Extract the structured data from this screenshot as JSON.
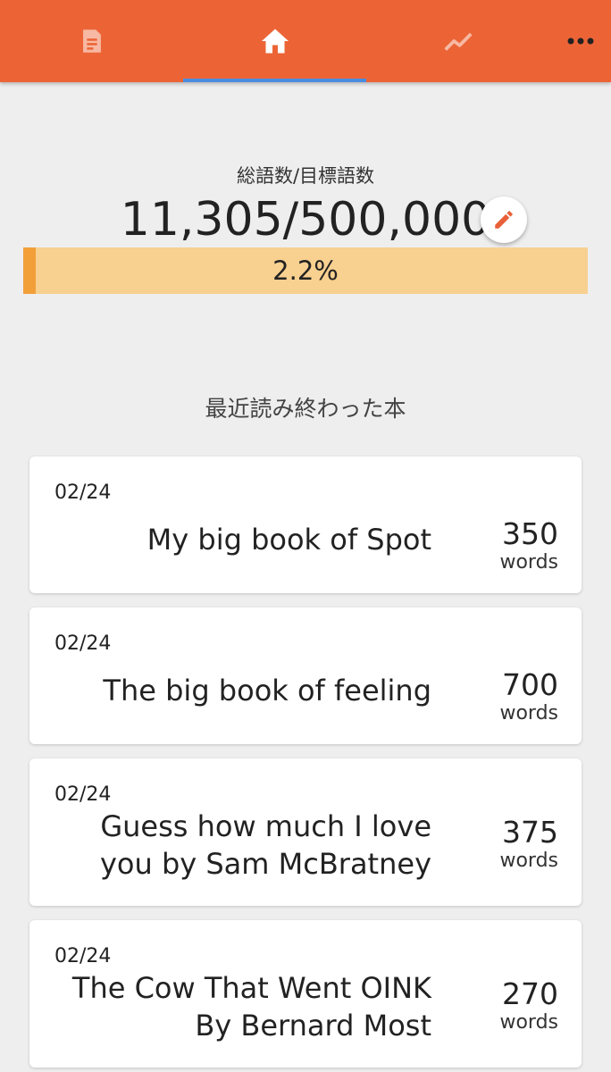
{
  "nav": {
    "tabs": [
      {
        "icon": "document-icon",
        "active": false
      },
      {
        "icon": "home-icon",
        "active": true
      },
      {
        "icon": "trend-chart-icon",
        "active": false
      },
      {
        "icon": "more-icon",
        "active": false
      }
    ],
    "colors": {
      "bar": "#ec6436",
      "indicator": "#4a8be0"
    }
  },
  "goal": {
    "label": "総語数/目標語数",
    "value": "11,305/500,000",
    "progress_text": "2.2%",
    "progress_fraction": 0.022,
    "colors": {
      "track": "#f8d090",
      "fill": "#f29f3a"
    }
  },
  "recent": {
    "title": "最近読み終わった本",
    "books": [
      {
        "date": "02/24",
        "title_lines": [
          "My big book of Spot"
        ],
        "count": "350",
        "unit": "words"
      },
      {
        "date": "02/24",
        "title_lines": [
          "The big book of feeling"
        ],
        "count": "700",
        "unit": "words"
      },
      {
        "date": "02/24",
        "title_lines": [
          "Guess how much I love",
          "you by Sam McBratney"
        ],
        "count": "375",
        "unit": "words"
      },
      {
        "date": "02/24",
        "title_lines": [
          "The Cow That Went OINK",
          "By Bernard Most"
        ],
        "count": "270",
        "unit": "words"
      }
    ]
  }
}
